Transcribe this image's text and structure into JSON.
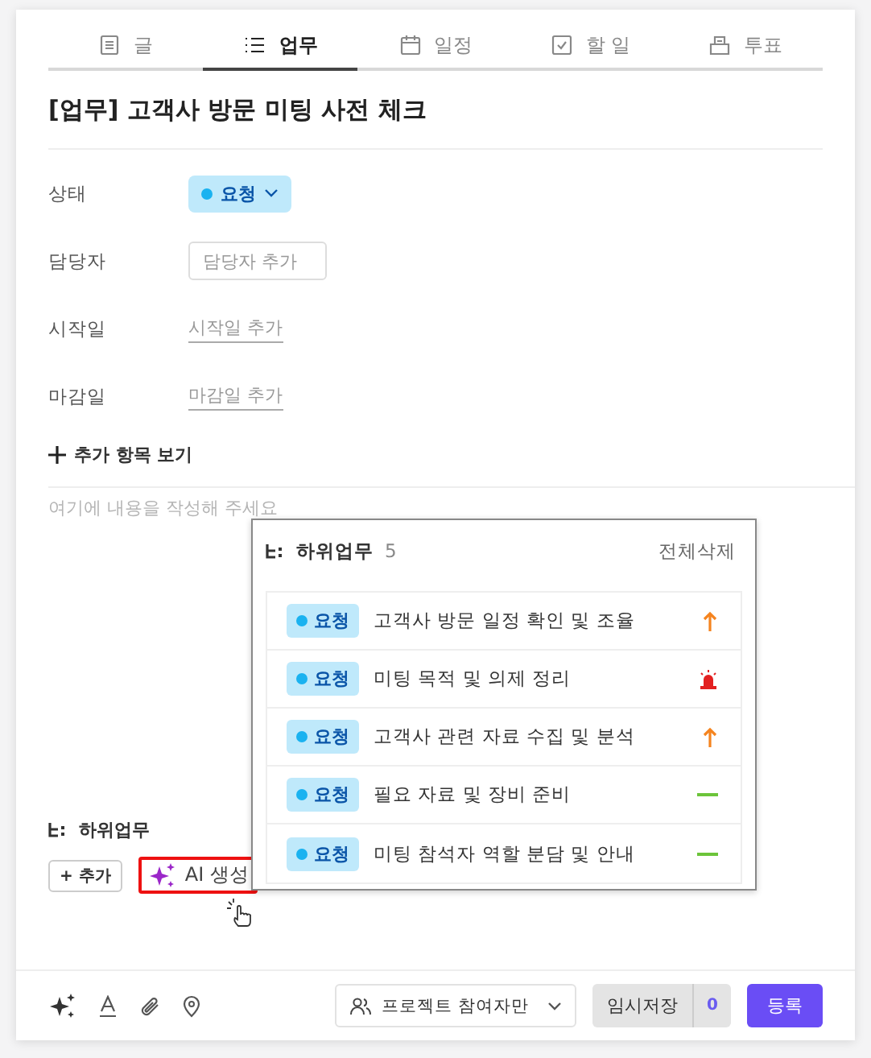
{
  "tabs": [
    {
      "label": "글",
      "kind": "doc",
      "selected": false
    },
    {
      "label": "업무",
      "kind": "list",
      "selected": true
    },
    {
      "label": "일정",
      "kind": "calendar",
      "selected": false
    },
    {
      "label": "할 일",
      "kind": "check",
      "selected": false
    },
    {
      "label": "투표",
      "kind": "vote",
      "selected": false
    }
  ],
  "title": "[업무] 고객사 방문 미팅 사전 체크",
  "fields": [
    {
      "label": "상태",
      "kind": "status",
      "value": "요청",
      "color": "#1ab2f0"
    },
    {
      "label": "담당자",
      "kind": "input",
      "placeholder": "담당자 추가"
    },
    {
      "label": "시작일",
      "kind": "link",
      "value": "시작일 추가"
    },
    {
      "label": "마감일",
      "kind": "link",
      "value": "마감일 추가"
    }
  ],
  "more_fields": "추가 항목 보기",
  "editor": {
    "placeholder": "여기에 내용을 작성해 주세요"
  },
  "subtask_popup": {
    "title": "하위업무",
    "count": "5",
    "delete_all": "전체삭제",
    "items": [
      {
        "status": "요청",
        "title": "고객사 방문 일정 확인 및 조율",
        "kind": "high"
      },
      {
        "status": "요청",
        "title": "미팅 목적 및 의제 정리",
        "kind": "urgent"
      },
      {
        "status": "요청",
        "title": "고객사 관련 자료 수집 및 분석",
        "kind": "high"
      },
      {
        "status": "요청",
        "title": "필요 자료 및 장비 준비",
        "kind": "normal"
      },
      {
        "status": "요청",
        "title": "미팅 참석자 역할 분담 및 안내",
        "kind": "normal"
      }
    ]
  },
  "subtasks": {
    "label": "하위업무",
    "add_button": "+ 추가",
    "ai_button": {
      "label": "AI 생성",
      "highlighted": true
    }
  },
  "footer": {
    "visibility": "프로젝트 참여자만",
    "draft_button": "임시저장",
    "draft_count": "0",
    "submit_button": "등록"
  }
}
